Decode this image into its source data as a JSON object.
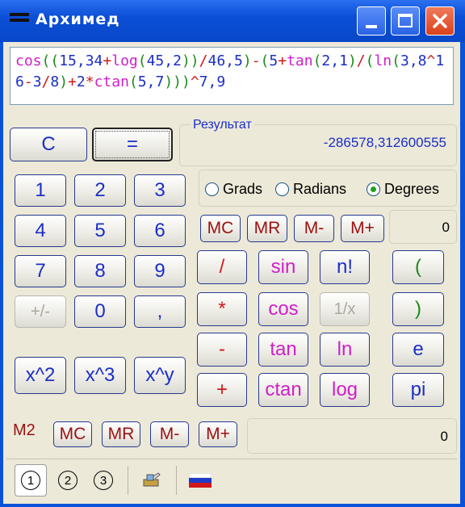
{
  "window": {
    "title": "Архимед"
  },
  "expression": {
    "tokens": [
      {
        "t": "cos",
        "c": "fn"
      },
      {
        "t": "((",
        "c": "par"
      },
      {
        "t": "15,34",
        "c": "num"
      },
      {
        "t": "+",
        "c": "op"
      },
      {
        "t": "log",
        "c": "fn"
      },
      {
        "t": "(",
        "c": "par"
      },
      {
        "t": "45,2",
        "c": "num"
      },
      {
        "t": "))",
        "c": "par"
      },
      {
        "t": "/",
        "c": "op"
      },
      {
        "t": "46,5",
        "c": "num"
      },
      {
        "t": ")",
        "c": "par"
      },
      {
        "t": "-",
        "c": "op"
      },
      {
        "t": "(",
        "c": "par"
      },
      {
        "t": "5",
        "c": "num"
      },
      {
        "t": "+",
        "c": "op"
      },
      {
        "t": "tan",
        "c": "fn"
      },
      {
        "t": "(",
        "c": "par"
      },
      {
        "t": "2,1",
        "c": "num"
      },
      {
        "t": ")",
        "c": "par"
      },
      {
        "t": "/",
        "c": "op"
      },
      {
        "t": "(",
        "c": "par"
      },
      {
        "t": "ln",
        "c": "fn"
      },
      {
        "t": "(",
        "c": "par"
      },
      {
        "t": "3,8",
        "c": "num"
      },
      {
        "t": "^",
        "c": "op"
      },
      {
        "t": "16",
        "c": "num"
      },
      {
        "t": "-",
        "c": "op"
      },
      {
        "t": "3",
        "c": "num"
      },
      {
        "t": "/",
        "c": "op"
      },
      {
        "t": "8",
        "c": "num"
      },
      {
        "t": ")",
        "c": "par"
      },
      {
        "t": "+",
        "c": "op"
      },
      {
        "t": "2",
        "c": "num"
      },
      {
        "t": "*",
        "c": "op"
      },
      {
        "t": "ctan",
        "c": "fn"
      },
      {
        "t": "(",
        "c": "par"
      },
      {
        "t": "5,7",
        "c": "num"
      },
      {
        "t": ")))",
        "c": "par"
      },
      {
        "t": "^",
        "c": "op"
      },
      {
        "t": "7,9",
        "c": "num"
      }
    ]
  },
  "buttons": {
    "clear": "C",
    "equals": "=",
    "d1": "1",
    "d2": "2",
    "d3": "3",
    "d4": "4",
    "d5": "5",
    "d6": "6",
    "d7": "7",
    "d8": "8",
    "d9": "9",
    "d0": "0",
    "sign": "+/-",
    "dot": ",",
    "sq": "x^2",
    "cube": "x^3",
    "pow": "x^y",
    "div": "/",
    "mul": "*",
    "sub": "-",
    "add": "+",
    "sin": "sin",
    "cos": "cos",
    "tan": "tan",
    "ctan": "ctan",
    "fact": "n!",
    "inv": "1/x",
    "ln": "ln",
    "log": "log",
    "lpar": "(",
    "rpar": ")",
    "e": "e",
    "pi": "pi",
    "mc": "MC",
    "mr": "MR",
    "mminus": "M-",
    "mplus": "M+"
  },
  "result": {
    "label": "Результат",
    "value": "-286578,312600555"
  },
  "angle": {
    "grads": "Grads",
    "radians": "Radians",
    "degrees": "Degrees",
    "selected": "Degrees"
  },
  "memory1": {
    "value": "0"
  },
  "memory2": {
    "label": "M2",
    "value": "0"
  },
  "status": {
    "tab1": "1",
    "tab2": "2",
    "tab3": "3"
  },
  "colors": {
    "number": "#1b2ec8",
    "function": "#d020c8",
    "operator": "#d01818",
    "paren": "#1a8a1a",
    "memory": "#9b1010"
  }
}
